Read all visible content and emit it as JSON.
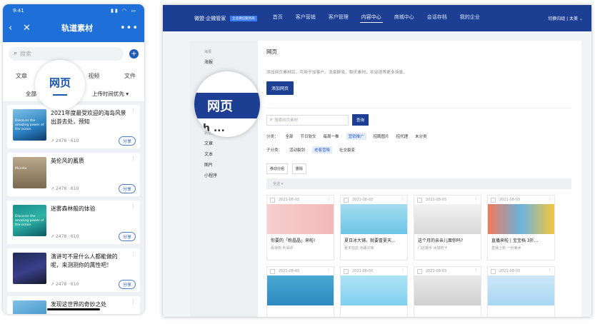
{
  "phone": {
    "status_time": "9:41",
    "status_icons": "▮▮ ◠ ▭",
    "title": "轨道素材",
    "back_icon": "‹",
    "close_icon": "✕",
    "more_icon": "•••",
    "search_placeholder": "搜索",
    "add_icon": "+",
    "tabs": [
      "文章",
      "网页",
      "视频",
      "文件"
    ],
    "filter_all": "全部",
    "filter_sort": "上传时间优先",
    "magnified_tab": "网页",
    "items": [
      {
        "title": "2021年度最受欢迎的海岛风景出游去处，预知",
        "thumb_text": "Discover the amazing power of the ocean",
        "meta": "2478 · 610",
        "share": "分享"
      },
      {
        "title": "英伦风的蓄质",
        "thumb_text": "Mondia",
        "meta": "2478 · 610",
        "share": "分享"
      },
      {
        "title": "迷雾森林般的体验",
        "thumb_text": "Discover the amazing power of the ocean",
        "meta": "2478 · 610",
        "share": "分享"
      },
      {
        "title": "演讲可不是什么人都能做的呢，来测测你的属性吧！",
        "thumb_text": "",
        "meta": "2478 · 610",
        "share": "分享"
      },
      {
        "title": "发现这世界的奇妙之处",
        "thumb_text": "",
        "meta": "",
        "share": ""
      }
    ]
  },
  "desktop": {
    "brand": "微盟·企微管家",
    "version_badge": "企业微信服务商",
    "nav": [
      "首页",
      "客户营销",
      "客户管理",
      "内容中心",
      "商城中心",
      "会话存档",
      "我的企业"
    ],
    "active_nav": "内容中心",
    "account": "切换归组 | 太美 ⌄",
    "sidebar": {
      "group1": "海报",
      "item1": "海报",
      "group2": "轨道素材",
      "items": [
        "文章",
        "文本",
        "图片",
        "小程序"
      ]
    },
    "magnified_label": "网页",
    "magnified_fragment": "h ...",
    "page_heading": "网页",
    "description": "添加网页素材后，可用于加客户、消息群发、聊天素材、欢迎语等更多场景。",
    "add_button": "添加网页",
    "search_placeholder": "搜索网页素材",
    "search_button": "查询",
    "category_label": "分类：",
    "categories": [
      "全部",
      "节日软文",
      "每周一推",
      "营销推广",
      "招聘图片",
      "招代理",
      "未分类"
    ],
    "selected_category": "营销推广",
    "subcategory_label": "子分类：",
    "subcategories": [
      "活动裂剑",
      "老客营降",
      "社交裂变"
    ],
    "selected_subcategory": "老客营降",
    "batch_group": "移动分组",
    "batch_delete": "删除",
    "table_hint": "全选 ▾",
    "cards": [
      {
        "date": "2021-08-03",
        "title": "你要的「粉晶晶」来啦!",
        "sub": "看得到 利润评"
      },
      {
        "date": "2021-08-03",
        "title": "夏日冰大铺，就要冒夏天...",
        "sub": "夏天在店 冰霜冷库"
      },
      {
        "date": "2021-08-03",
        "title": "这个月的亲亲儿面你吗?",
        "sub": "门店钢手 冰球时卡"
      },
      {
        "date": "2021-08-03",
        "title": "直播来啦 | 宝宝档 3折...",
        "sub": "直播上新 一份美术"
      },
      {
        "date": "2021-08-03",
        "title": "",
        "sub": ""
      },
      {
        "date": "2021-08-03",
        "title": "",
        "sub": ""
      },
      {
        "date": "2021-08-03",
        "title": "",
        "sub": ""
      },
      {
        "date": "2021-08-03",
        "title": "",
        "sub": ""
      }
    ]
  }
}
